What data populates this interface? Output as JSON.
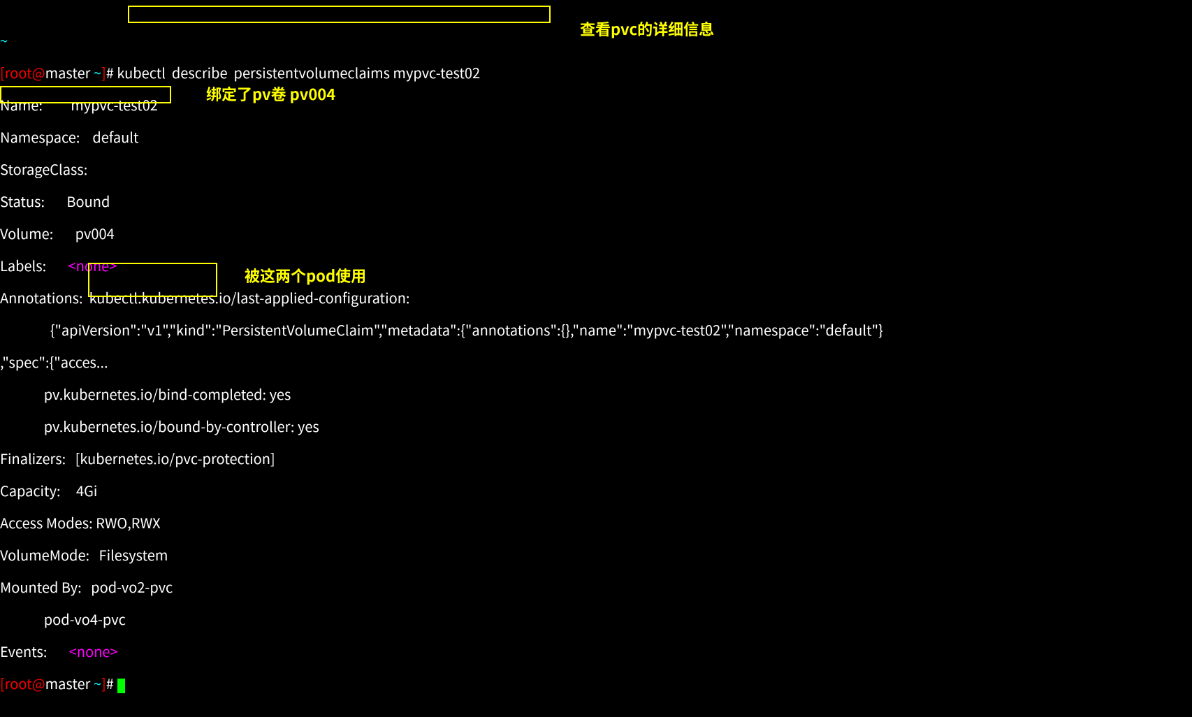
{
  "top_cut": "~",
  "prompt": {
    "open": "[",
    "user": "root",
    "at": "@",
    "host": "master",
    "path": " ~",
    "close": "]",
    "hash": "# "
  },
  "cmd": "kubectl  describe  persistentvolumeclaims mypvc-test02",
  "fields": {
    "name_label": "Name:         ",
    "name_value": "mypvc-test02",
    "namespace_label": "Namespace:    ",
    "namespace_value": "default",
    "storageclass_label": "StorageClass: ",
    "storageclass_value": "",
    "status_label": "Status:       ",
    "status_value": "Bound",
    "volume_label": "Volume:       ",
    "volume_value": "pv004",
    "labels_label": "Labels:       ",
    "labels_value": "<none>",
    "annotations_label": "Annotations:  ",
    "annotations_value1": "kubectl.kubernetes.io/last-applied-configuration:",
    "annotations_indent": "                ",
    "annotations_value2": "{\"apiVersion\":\"v1\",\"kind\":\"PersistentVolumeClaim\",\"metadata\":{\"annotations\":{},\"name\":\"mypvc-test02\",\"namespace\":\"default\"}",
    "annotations_wrap": ",\"spec\":{\"acces...",
    "anno_bind_completed": "pv.kubernetes.io/bind-completed: yes",
    "anno_bound_by_ctrl": "pv.kubernetes.io/bound-by-controller: yes",
    "finalizers_label": "Finalizers:   ",
    "finalizers_value": "[kubernetes.io/pvc-protection]",
    "capacity_label": "Capacity:     ",
    "capacity_value": "4Gi",
    "access_label": "Access Modes: ",
    "access_value": "RWO,RWX",
    "volmode_label": "VolumeMode:   ",
    "volmode_value": "Filesystem",
    "mounted_label": "Mounted By:   ",
    "mounted_value1": "pod-vo2-pvc",
    "mounted_indent": "              ",
    "mounted_value2": "pod-vo4-pvc",
    "events_label": "Events:       ",
    "events_value": "<none>"
  },
  "annotations_text": {
    "see_pvc_detail": "查看pvc的详细信息",
    "bound_pv": "绑定了pv卷  pv004",
    "used_by_pods": "被这两个pod使用"
  }
}
